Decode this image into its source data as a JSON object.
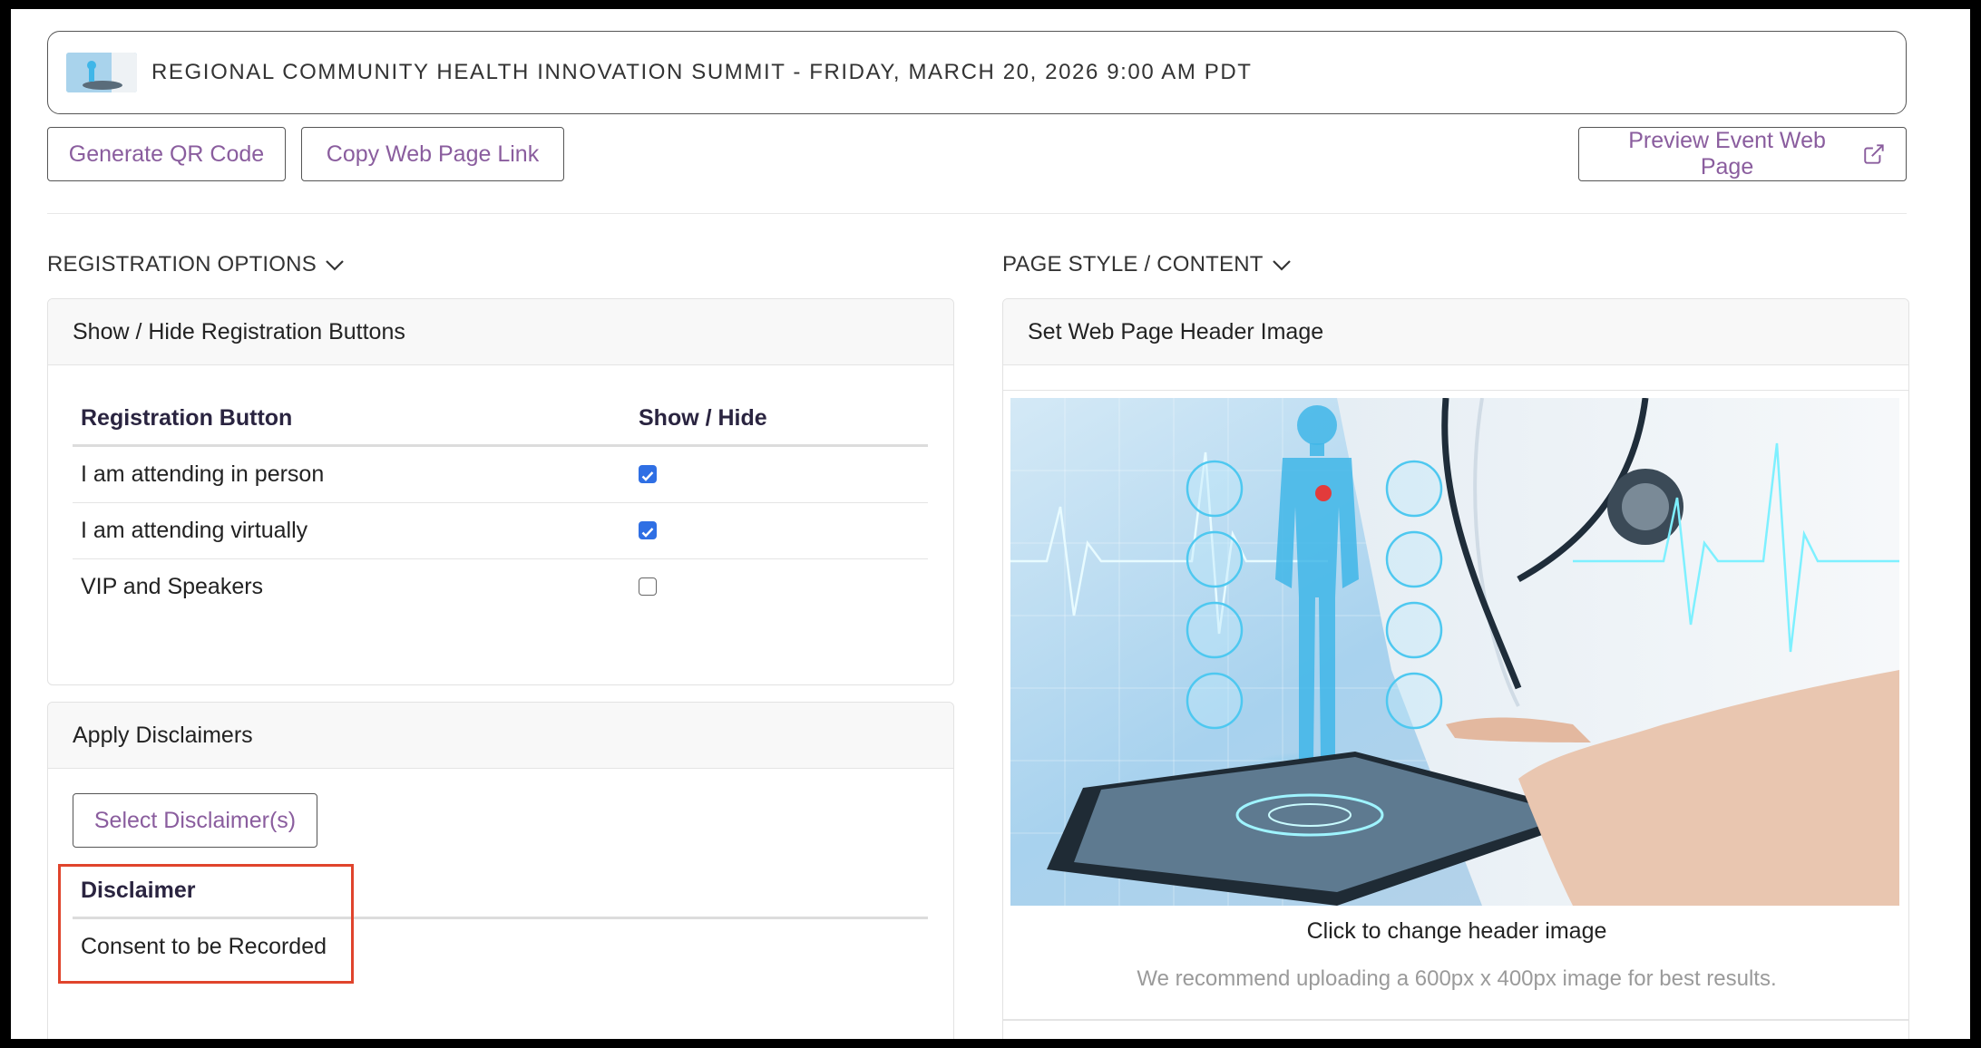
{
  "event": {
    "title": "REGIONAL COMMUNITY HEALTH INNOVATION SUMMIT - FRIDAY, MARCH 20, 2026 9:00 AM PDT"
  },
  "toolbar": {
    "generate_qr_label": "Generate QR Code",
    "copy_link_label": "Copy Web Page Link",
    "preview_label": "Preview Event Web Page"
  },
  "registration_options": {
    "heading": "REGISTRATION OPTIONS",
    "card_title": "Show / Hide Registration Buttons",
    "columns": [
      "Registration Button",
      "Show / Hide"
    ],
    "rows": [
      {
        "label": "I am attending in person",
        "shown": true
      },
      {
        "label": "I am attending virtually",
        "shown": true
      },
      {
        "label": "VIP and Speakers",
        "shown": false
      }
    ]
  },
  "disclaimers": {
    "card_title": "Apply Disclaimers",
    "select_label": "Select Disclaimer(s)",
    "column": "Disclaimer",
    "rows": [
      "Consent to be Recorded"
    ]
  },
  "page_style": {
    "heading": "PAGE STYLE / CONTENT",
    "card_title": "Set Web Page Header Image",
    "click_text": "Click to change header image",
    "recommendation": "We recommend uploading a 600px x 400px image for best results."
  },
  "icons": {
    "chevron": "chevron-down-icon",
    "external": "external-link-icon",
    "checkbox_on": "checkbox-checked",
    "checkbox_off": "checkbox-unchecked"
  },
  "colors": {
    "accent": "#8a5d9e",
    "checkbox": "#2f6fe4",
    "highlight": "#e0442c"
  }
}
